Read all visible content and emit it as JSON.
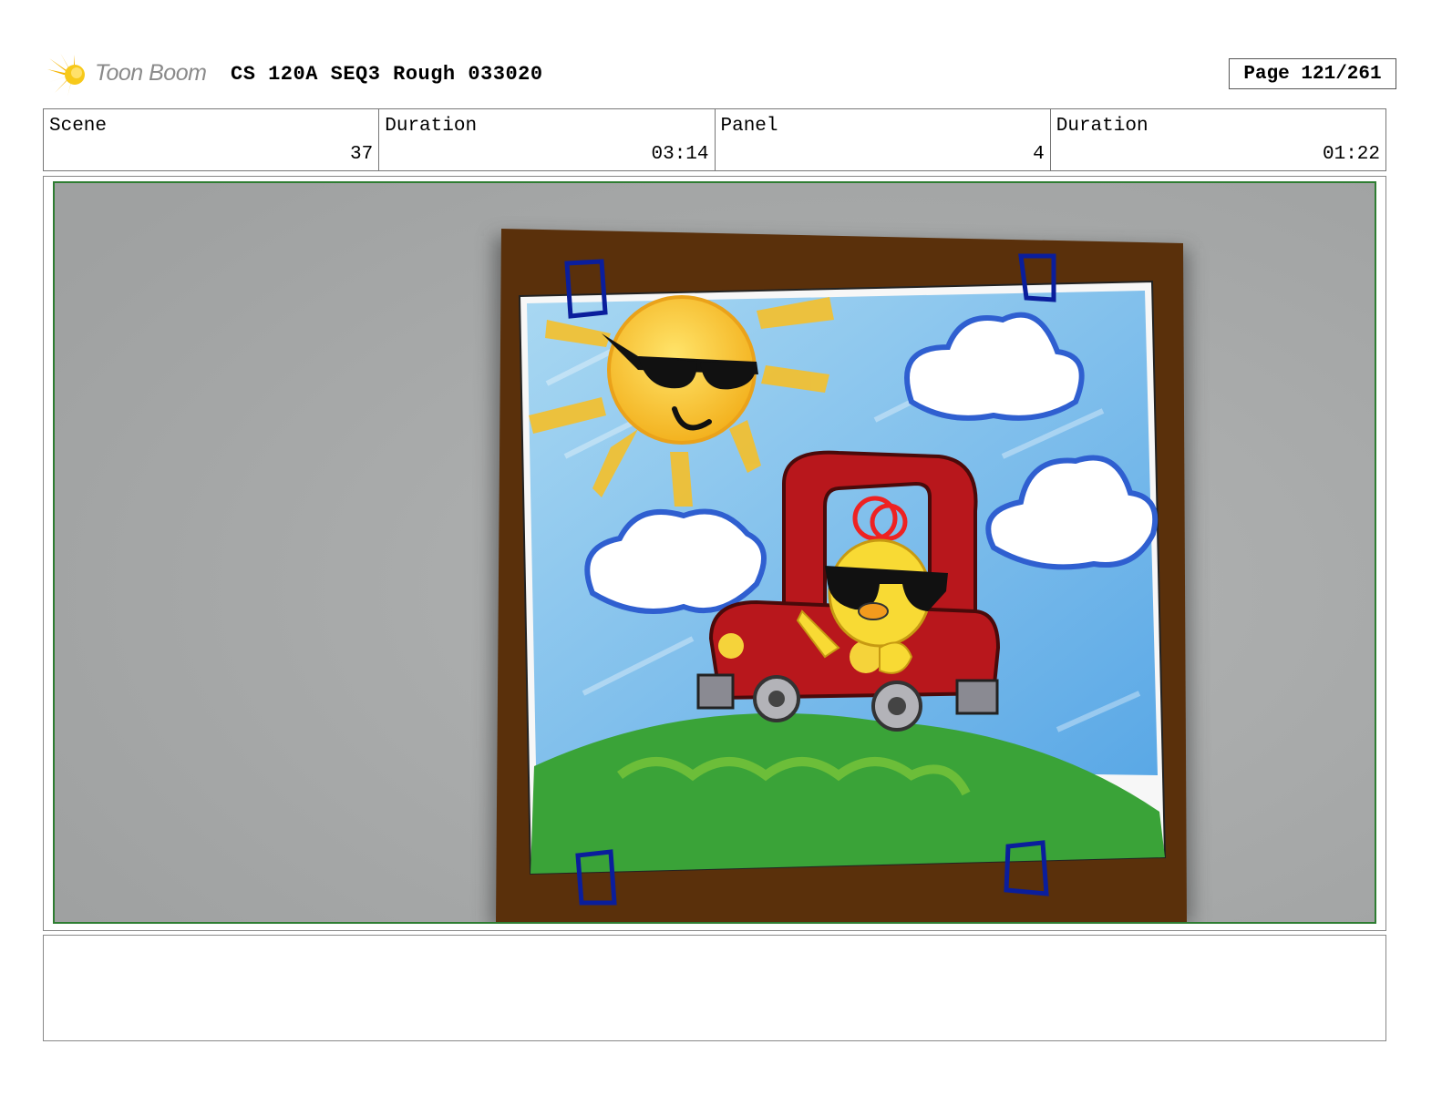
{
  "header": {
    "brand": "Toon Boom",
    "title": "CS 120A SEQ3 Rough 033020",
    "page": "Page 121/261"
  },
  "info": {
    "scene_label": "Scene",
    "scene_value": "37",
    "scene_duration_label": "Duration",
    "scene_duration_value": "03:14",
    "panel_label": "Panel",
    "panel_value": "4",
    "panel_duration_label": "Duration",
    "panel_duration_value": "01:22"
  },
  "colors": {
    "frame_border": "#2e7d32",
    "panel_bg": "#a6a8a8",
    "picture_frame": "#5a300b",
    "tape": "#0a1e9c"
  },
  "artwork": {
    "subject": "crayon drawing of sun with sunglasses and chick driving red toy car, taped to brown board"
  },
  "notes": {
    "text": ""
  }
}
